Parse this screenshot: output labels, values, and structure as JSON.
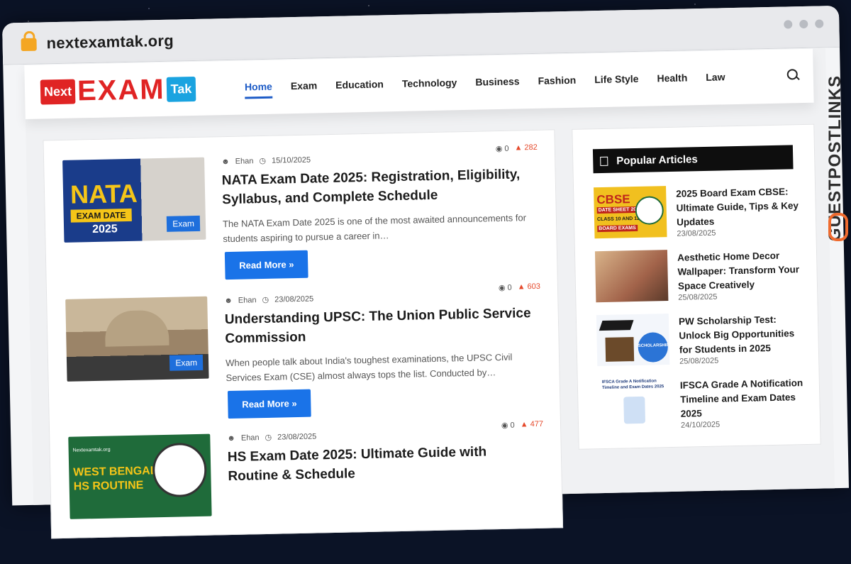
{
  "browser": {
    "url": "nextexamtak.org"
  },
  "logo": {
    "part1": "Next",
    "part2": "EXAM",
    "part3": "Tak"
  },
  "nav": [
    "Home",
    "Exam",
    "Education",
    "Technology",
    "Business",
    "Fashion",
    "Life Style",
    "Health",
    "Law"
  ],
  "posts": [
    {
      "author": "Ehan",
      "date": "15/10/2025",
      "comments": "0",
      "views": "282",
      "title": "NATA Exam Date 2025: Registration, Eligibility, Syllabus, and Complete Schedule",
      "excerpt": "The NATA Exam Date 2025 is one of the most awaited announcements for students aspiring to pursue a career in…",
      "category": "Exam",
      "read_more": "Read More »",
      "thumb_text": [
        "NATA",
        "EXAM DATE",
        "2025"
      ]
    },
    {
      "author": "Ehan",
      "date": "23/08/2025",
      "comments": "0",
      "views": "603",
      "title": "Understanding UPSC: The Union Public Service Commission",
      "excerpt": "When people talk about India's toughest examinations, the UPSC Civil Services Exam (CSE) almost always tops the list. Conducted by…",
      "category": "Exam",
      "read_more": "Read More »"
    },
    {
      "author": "Ehan",
      "date": "23/08/2025",
      "comments": "0",
      "views": "477",
      "title": "HS Exam Date 2025: Ultimate Guide with Routine & Schedule",
      "thumb_text": [
        "Nextexamtak.org",
        "WEST BENGAL",
        "HS ROUTINE"
      ]
    }
  ],
  "sidebar": {
    "title": "Popular Articles",
    "items": [
      {
        "title": "2025 Board Exam CBSE: Ultimate Guide, Tips & Key Updates",
        "date": "23/08/2025",
        "thumb_text": [
          "CBSE",
          "DATE SHEET 2025",
          "CLASS 10 AND 12",
          "BOARD EXAMS"
        ]
      },
      {
        "title": "Aesthetic Home Decor Wallpaper: Transform Your Space Creatively",
        "date": "25/08/2025"
      },
      {
        "title": "PW Scholarship Test: Unlock Big Opportunities for Students in 2025",
        "date": "25/08/2025",
        "thumb_text": [
          "SCHOLARSHIP"
        ]
      },
      {
        "title": "IFSCA Grade A Notification Timeline and Exam Dates 2025",
        "date": "24/10/2025",
        "thumb_text": [
          "IFSCA Grade A Notification",
          "Timeline and Exam Dates 2025"
        ]
      }
    ]
  },
  "watermark": "GUESTPOSTLINKS",
  "colors": {
    "accent": "#1e5cc7",
    "button": "#1a73e8",
    "brand_red": "#e02424",
    "brand_blue": "#1aa3e0",
    "views": "#e5492b"
  }
}
